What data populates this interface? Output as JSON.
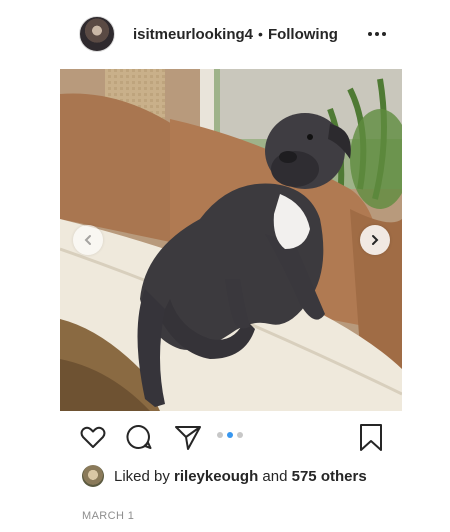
{
  "post": {
    "author": {
      "username": "isitmeurlooking4",
      "separator": "•",
      "follow_status": "Following"
    },
    "more_icon": "more-options-icon",
    "carousel": {
      "slide_count": 3,
      "active_slide": 2,
      "prev_icon": "chevron-left-icon",
      "next_icon": "chevron-right-icon"
    },
    "actions": {
      "like_icon": "heart-icon",
      "comment_icon": "comment-icon",
      "share_icon": "send-icon",
      "save_icon": "bookmark-icon"
    },
    "likes": {
      "prefix": "Liked by",
      "user": "rileykeough",
      "joiner": "and",
      "others": "575 others"
    },
    "date": "MARCH 1"
  },
  "colors": {
    "text": "#262626",
    "muted": "#8e8e8e",
    "accent_dot": "#3897f0",
    "inactive_dot": "#c7c7c7"
  }
}
